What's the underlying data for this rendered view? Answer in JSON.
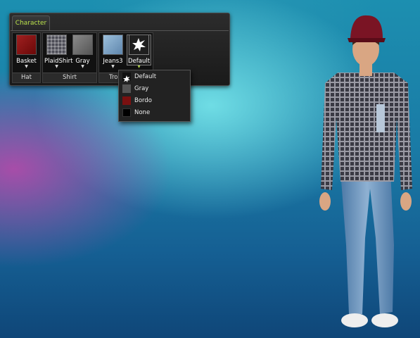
{
  "panel": {
    "tab_label": "Character",
    "groups": [
      {
        "label": "Hat",
        "items": [
          {
            "label": "Basket",
            "swatch": "red"
          }
        ]
      },
      {
        "label": "Shirt",
        "items": [
          {
            "label": "PlaidShirt",
            "swatch": "plaid"
          },
          {
            "label": "Gray",
            "swatch": "gray"
          }
        ]
      },
      {
        "label": "Trou",
        "items": [
          {
            "label": "Jeans3",
            "swatch": "jeans"
          },
          {
            "label": "Default",
            "swatch": "default"
          }
        ]
      }
    ]
  },
  "dropdown": {
    "options": [
      {
        "label": "Default",
        "color": "#111111",
        "icon": "star-splat-icon"
      },
      {
        "label": "Gray",
        "color": "#555555"
      },
      {
        "label": "Bordo",
        "color": "#7a1010"
      },
      {
        "label": "None",
        "color": "#000000"
      }
    ]
  },
  "colors": {
    "tab_text": "#b9e04a",
    "hat": "#7a1424",
    "jeans": "#6f95bd"
  }
}
